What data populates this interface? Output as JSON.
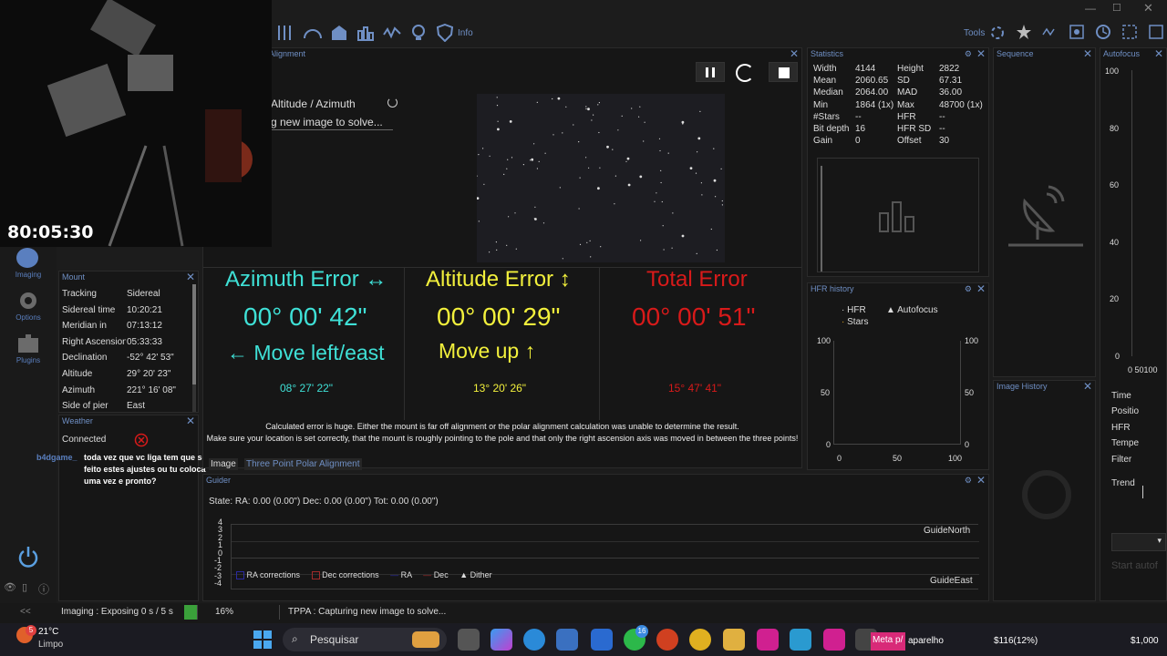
{
  "toolbar": {
    "info_label": "Info",
    "tools_label": "Tools"
  },
  "webcam": {
    "timer": "80:05:30"
  },
  "sidebar": {
    "items": [
      {
        "label": "Imaging"
      },
      {
        "label": "Options"
      },
      {
        "label": "Plugins"
      }
    ]
  },
  "mount": {
    "title": "Mount",
    "rows": [
      {
        "key": "Tracking",
        "value": "Sidereal"
      },
      {
        "key": "Sidereal time",
        "value": "10:20:21"
      },
      {
        "key": "Meridian in",
        "value": "07:13:12"
      },
      {
        "key": "Right Ascension",
        "value": "05:33:33"
      },
      {
        "key": "Declination",
        "value": "-52° 42' 53\""
      },
      {
        "key": "Altitude",
        "value": "29° 20' 23\""
      },
      {
        "key": "Azimuth",
        "value": "221° 16' 08\""
      },
      {
        "key": "Side of pier",
        "value": "East"
      }
    ]
  },
  "weather": {
    "title": "Weather",
    "status": "Connected"
  },
  "chat": {
    "user": "b4dgame_",
    "message": "toda vez que vc liga tem que ser feito estes ajustes ou tu coloca uma vez e pronto?"
  },
  "polar": {
    "title": "Alignment",
    "mode": "Altitude / Azimuth",
    "status": "g new image to solve...",
    "azimuth": {
      "title": "Azimuth Error ↔",
      "value": "00° 00' 42\"",
      "move": "← Move left/east",
      "sub": "08° 27' 22\"",
      "color": "#3fe0d6"
    },
    "altitude": {
      "title": "Altitude Error ↕",
      "value": "00° 00' 29\"",
      "move": "Move up ↑",
      "sub": "13° 20' 26\"",
      "color": "#f2f03c"
    },
    "total": {
      "title": "Total Error",
      "value": "00° 00' 51\"",
      "sub": "15° 47' 41\"",
      "color": "#d81a1a"
    },
    "warning1": "Calculated error is huge. Either the mount is far off alignment or the polar alignment calculation was unable to determine the result.",
    "warning2": "Make sure your location is set correctly, that the mount is roughly pointing to the pole and that only the right ascension axis was moved in between the three points!",
    "tab_image": "Image",
    "tab_tppa": "Three Point Polar Alignment"
  },
  "statistics": {
    "title": "Statistics",
    "rows": [
      [
        "Width",
        "4144",
        "Height",
        "2822"
      ],
      [
        "Mean",
        "2060.65",
        "SD",
        "67.31"
      ],
      [
        "Median",
        "2064.00",
        "MAD",
        "36.00"
      ],
      [
        "Min",
        "1864 (1x)",
        "Max",
        "48700 (1x)"
      ],
      [
        "#Stars",
        "--",
        "HFR",
        "--"
      ],
      [
        "Bit depth",
        "16",
        "HFR SD",
        "--"
      ],
      [
        "Gain",
        "0",
        "Offset",
        "30"
      ]
    ]
  },
  "hfr_history": {
    "title": "HFR history",
    "legend": [
      "HFR",
      "Autofocus",
      "Stars"
    ],
    "y_ticks": [
      "100",
      "50",
      "0"
    ],
    "x_ticks": [
      "0",
      "50",
      "100"
    ]
  },
  "sequence": {
    "title": "Sequence"
  },
  "image_history": {
    "title": "Image History"
  },
  "autofocus": {
    "title": "Autofocus",
    "y_ticks": [
      "100",
      "80",
      "60",
      "40",
      "20",
      "0"
    ],
    "x_ticks": "0 50100",
    "fields": [
      "Time",
      "Positio",
      "HFR",
      "Tempe",
      "Filter",
      "Trend"
    ],
    "start_label": "Start autof"
  },
  "guider": {
    "title": "Guider",
    "state": "State:  RA: 0.00 (0.00\")  Dec: 0.00 (0.00\")  Tot: 0.00 (0.00\")",
    "y_ticks": [
      "4",
      "3",
      "2",
      "1",
      "0",
      "-1",
      "-2",
      "-3",
      "-4"
    ],
    "north": "GuideNorth",
    "east": "GuideEast",
    "legend": [
      "RA corrections",
      "Dec corrections",
      "RA",
      "Dec",
      "Dither"
    ]
  },
  "statusbar": {
    "collapse": "<<",
    "imaging": "Imaging :  Exposing 0 s / 5 s",
    "percent": "16%",
    "tppa": "TPPA :  Capturing new image to solve..."
  },
  "taskbar": {
    "temp": "21°C",
    "weather": "Limpo",
    "weather_badge": "5",
    "search": "Pesquisar",
    "whatsapp_badge": "16",
    "overlay_label": "Meta p/",
    "overlay_text": "aparelho",
    "money1": "$116(12%)",
    "money2": "$1,000"
  },
  "colors": {
    "accent": "#5a7fbf",
    "bg": "#1c1c1c"
  }
}
